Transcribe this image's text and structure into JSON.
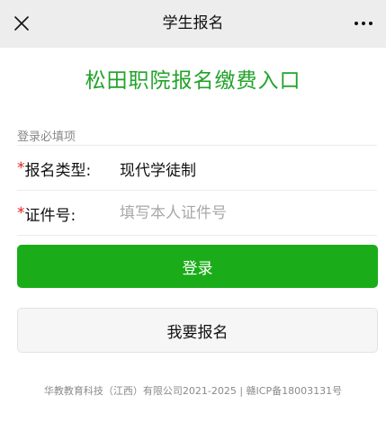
{
  "header": {
    "title": "学生报名",
    "close_icon": "close-icon",
    "more_icon": "more-dots-icon"
  },
  "main": {
    "heading": "松田职院报名缴费入口",
    "section_label": "登录必填项",
    "fields": {
      "type": {
        "required_mark": "*",
        "label": "报名类型:",
        "value": "现代学徒制"
      },
      "id_number": {
        "required_mark": "*",
        "label": "证件号:",
        "placeholder": "填写本人证件号"
      }
    },
    "login_button": "登录",
    "register_button": "我要报名"
  },
  "footer": {
    "text": "华教教育科技（江西）有限公司2021-2025 | 赣ICP备18003131号"
  },
  "colors": {
    "accent_green": "#1aad19",
    "heading_green": "#22a32a",
    "required_red": "#e02020",
    "topbar_bg": "#ededed"
  }
}
